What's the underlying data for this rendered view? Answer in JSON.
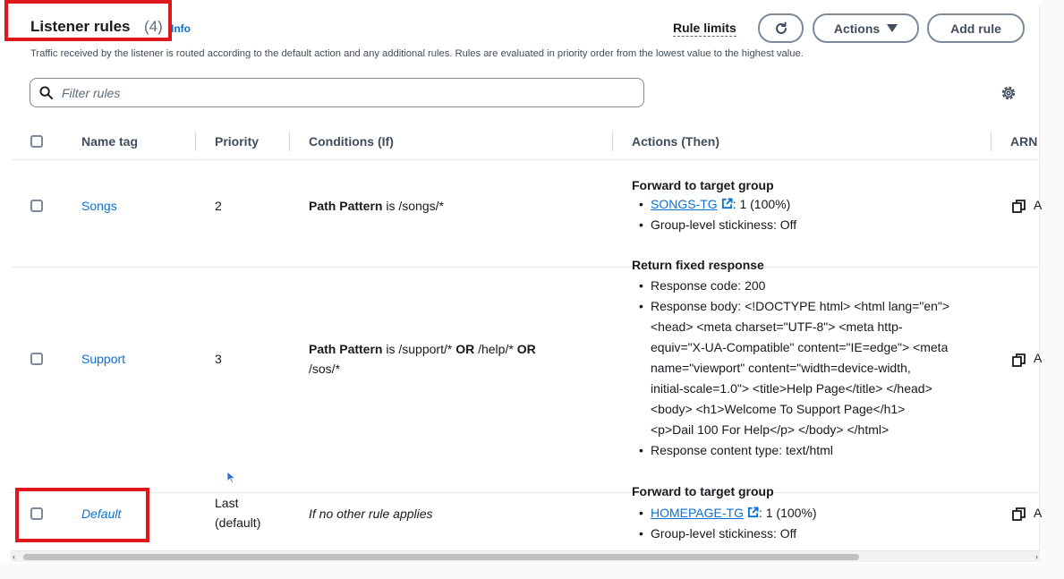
{
  "header": {
    "title": "Listener rules",
    "count": "(4)",
    "info": "Info",
    "description": "Traffic received by the listener is routed according to the default action and any additional rules. Rules are evaluated in priority order from the lowest value to the highest value."
  },
  "toolbar": {
    "rule_limits": "Rule limits",
    "actions_label": "Actions",
    "add_rule_label": "Add rule"
  },
  "filter": {
    "placeholder": "Filter rules"
  },
  "table": {
    "columns": [
      "Name tag",
      "Priority",
      "Conditions (If)",
      "Actions (Then)",
      "ARN"
    ],
    "rows": [
      {
        "name": "Songs",
        "priority": "2",
        "condition": {
          "field": "Path Pattern",
          "op": "is",
          "value": "/songs/*"
        },
        "action_title": "Forward to target group",
        "target_group": "SONGS-TG",
        "target_weight": ": 1 (100%)",
        "stickiness": "Group-level stickiness: Off",
        "arn_fragment": "A"
      },
      {
        "name": "Support",
        "priority": "3",
        "condition": {
          "field": "Path Pattern",
          "op": "is",
          "v1": "/support/*",
          "or1": "OR",
          "v2": "/help/*",
          "or2": "OR",
          "v3": "/sos/*"
        },
        "action_title": "Return fixed response",
        "response_code": "Response code: 200",
        "response_body_lines": [
          "Response body: <!DOCTYPE html> <html lang=\"en\">",
          "<head> <meta charset=\"UTF-8\"> <meta http-",
          "equiv=\"X-UA-Compatible\" content=\"IE=edge\"> <meta",
          "name=\"viewport\" content=\"width=device-width,",
          "initial-scale=1.0\"> <title>Help Page</title> </head>",
          "<body> <h1>Welcome To Support Page</h1>",
          "<p>Dail 100 For Help</p> </body> </html>"
        ],
        "content_type": "Response content type: text/html",
        "arn_fragment": "A"
      },
      {
        "name": "Default",
        "priority_line1": "Last",
        "priority_line2": "(default)",
        "condition_text": "If no other rule applies",
        "action_title": "Forward to target group",
        "target_group": "HOMEPAGE-TG",
        "target_weight": ": 1 (100%)",
        "stickiness": "Group-level stickiness: Off",
        "arn_fragment": "A"
      }
    ]
  },
  "colors": {
    "link": "#0972d3",
    "highlight": "#e0161d",
    "text": "#16191f",
    "muted": "#5f6b7a"
  },
  "icons": [
    "refresh-icon",
    "caret-down-icon",
    "search-icon",
    "gear-icon",
    "external-link-icon",
    "copy-icon",
    "mouse-cursor-icon"
  ]
}
